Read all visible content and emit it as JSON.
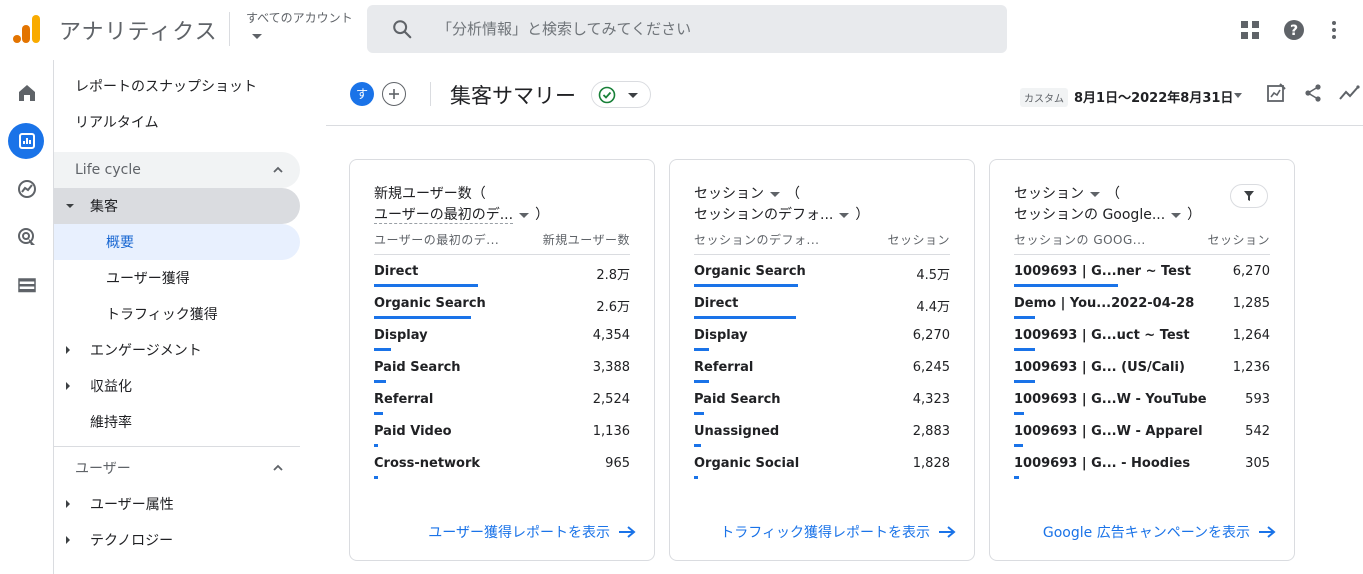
{
  "app": {
    "title": "アナリティクス",
    "account_label": "すべてのアカウント",
    "search_placeholder": "「分析情報」と検索してみてください"
  },
  "colors": {
    "accent": "#1a73e8",
    "logo_orange": "#f9ab00",
    "logo_dark": "#e37400"
  },
  "nav": {
    "items": [
      {
        "label": "レポートのスナップショット"
      },
      {
        "label": "リアルタイム"
      }
    ],
    "section_lifecycle": "Life cycle",
    "acquisition": "集客",
    "acquisition_children": [
      "概要",
      "ユーザー獲得",
      "トラフィック獲得"
    ],
    "engagement": "エンゲージメント",
    "monetization": "収益化",
    "retention": "維持率",
    "section_user": "ユーザー",
    "user_attributes": "ユーザー属性",
    "technology": "テクノロジー"
  },
  "header": {
    "avatar": "す",
    "title": "集客サマリー",
    "date_custom": "カスタム",
    "date_range": "8月1日〜2022年8月31日"
  },
  "cards": [
    {
      "title_line1": "新規ユーザー数（",
      "title_line2_a": "ユーザーの最初のデ...",
      "title_line2_b": "）",
      "col_left": "ユーザーの最初のデ...",
      "col_right": "新規ユーザー数",
      "rows": [
        {
          "label": "Direct",
          "value": "2.8万",
          "share": 1.0
        },
        {
          "label": "Organic Search",
          "value": "2.6万",
          "share": 0.93
        },
        {
          "label": "Display",
          "value": "4,354",
          "share": 0.16
        },
        {
          "label": "Paid Search",
          "value": "3,388",
          "share": 0.12
        },
        {
          "label": "Referral",
          "value": "2,524",
          "share": 0.09
        },
        {
          "label": "Paid Video",
          "value": "1,136",
          "share": 0.04
        },
        {
          "label": "Cross-network",
          "value": "965",
          "share": 0.035
        }
      ],
      "link": "ユーザー獲得レポートを表示"
    },
    {
      "title_line1": "セッション",
      "title_line1_b": "（",
      "title_line2_a": "セッションのデフォ...",
      "title_line2_b": "）",
      "col_left": "セッションのデフォ...",
      "col_right": "セッション",
      "rows": [
        {
          "label": "Organic Search",
          "value": "4.5万",
          "share": 1.0
        },
        {
          "label": "Direct",
          "value": "4.4万",
          "share": 0.98
        },
        {
          "label": "Display",
          "value": "6,270",
          "share": 0.14
        },
        {
          "label": "Referral",
          "value": "6,245",
          "share": 0.14
        },
        {
          "label": "Paid Search",
          "value": "4,323",
          "share": 0.1
        },
        {
          "label": "Unassigned",
          "value": "2,883",
          "share": 0.064
        },
        {
          "label": "Organic Social",
          "value": "1,828",
          "share": 0.04
        }
      ],
      "link": "トラフィック獲得レポートを表示"
    },
    {
      "title_line1": "セッション",
      "title_line1_b": "（",
      "title_line2_a": "セッションの Google...",
      "title_line2_b": "）",
      "col_left": "セッションの GOOG...",
      "col_right": "セッション",
      "rows": [
        {
          "label": "1009693 | G...ner ~ Test",
          "value": "6,270",
          "share": 1.0
        },
        {
          "label": "Demo | You...2022-04-28",
          "value": "1,285",
          "share": 0.2
        },
        {
          "label": "1009693 | G...uct ~ Test",
          "value": "1,264",
          "share": 0.2
        },
        {
          "label": "1009693 | G... (US/Cali)",
          "value": "1,236",
          "share": 0.2
        },
        {
          "label": "1009693 | G...W - YouTube",
          "value": "593",
          "share": 0.095
        },
        {
          "label": "1009693 | G...W - Apparel",
          "value": "542",
          "share": 0.086
        },
        {
          "label": "1009693 | G... - Hoodies",
          "value": "305",
          "share": 0.05
        }
      ],
      "link": "Google 広告キャンペーンを表示"
    }
  ]
}
